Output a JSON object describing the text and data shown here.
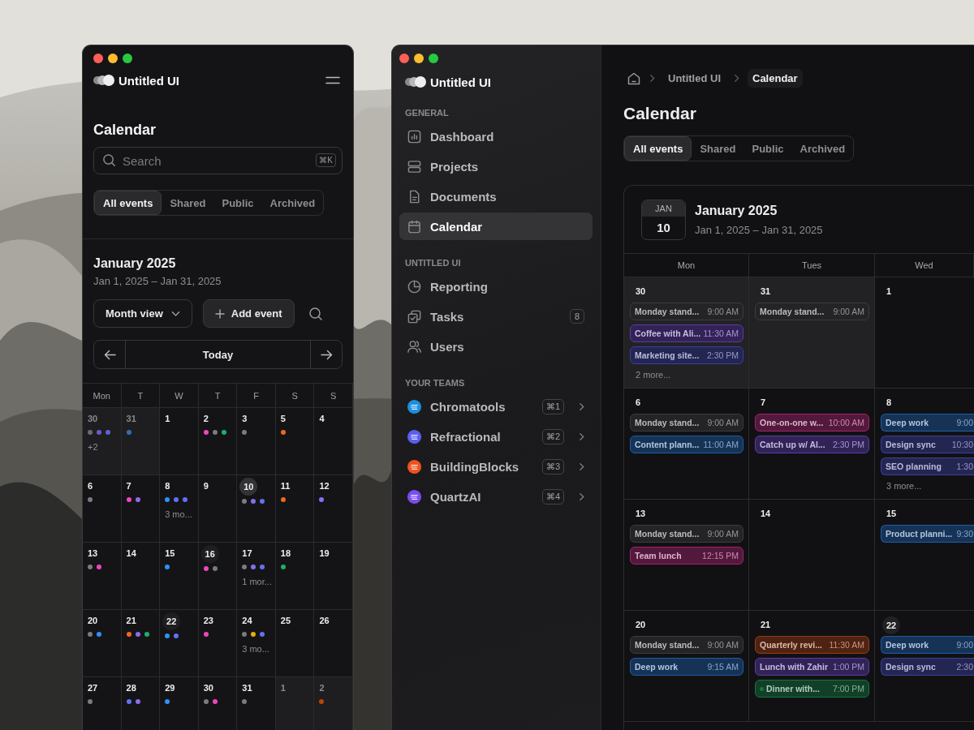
{
  "left_window": {
    "brand": "Untitled UI",
    "title": "Calendar",
    "search": {
      "placeholder": "Search",
      "shortcut": "⌘K"
    },
    "tabs": [
      {
        "label": "All events",
        "selected": true
      },
      {
        "label": "Shared",
        "selected": false
      },
      {
        "label": "Public",
        "selected": false
      },
      {
        "label": "Archived",
        "selected": false
      }
    ],
    "month": "January 2025",
    "range": "Jan 1, 2025 – Jan 31, 2025",
    "view_button": "Month view",
    "add_button": "Add event",
    "today_button": "Today",
    "weekdays": [
      "Mon",
      "T",
      "W",
      "T",
      "F",
      "S",
      "S"
    ],
    "days": [
      {
        "date": "30",
        "muted": true,
        "today": false,
        "ring": false,
        "dots": [
          {
            "color": "#6b6b70"
          },
          {
            "color": "#6e5bc4"
          },
          {
            "color": "#5b63d6"
          }
        ],
        "more": "+2"
      },
      {
        "date": "31",
        "muted": true,
        "today": false,
        "ring": false,
        "dots": [
          {
            "color": "#2f6fb8"
          }
        ]
      },
      {
        "date": "1",
        "muted": false,
        "today": false,
        "ring": false
      },
      {
        "date": "2",
        "muted": false,
        "today": false,
        "ring": false,
        "dots": [
          {
            "color": "#ee46bc"
          },
          {
            "color": "#7a7a80"
          },
          {
            "color": "#17b26a"
          }
        ]
      },
      {
        "date": "3",
        "muted": false,
        "today": false,
        "ring": false,
        "dots": [
          {
            "color": "#7a7a80"
          }
        ]
      },
      {
        "date": "5",
        "muted": false,
        "today": false,
        "ring": false,
        "dots": [
          {
            "color": "#ef6820"
          }
        ]
      },
      {
        "date": "4",
        "muted": false,
        "today": false,
        "ring": false
      },
      {
        "date": "6",
        "muted": false,
        "today": false,
        "ring": false,
        "dots": [
          {
            "color": "#7a7a80"
          }
        ]
      },
      {
        "date": "7",
        "muted": false,
        "today": false,
        "ring": false,
        "dots": [
          {
            "color": "#ee46bc"
          },
          {
            "color": "#8b6cf0"
          }
        ]
      },
      {
        "date": "8",
        "muted": false,
        "today": false,
        "ring": false,
        "dots": [
          {
            "color": "#2e90fa"
          },
          {
            "color": "#6172f3"
          },
          {
            "color": "#6172f3"
          }
        ],
        "more": "3 mo..."
      },
      {
        "date": "9",
        "muted": false,
        "today": false,
        "ring": false
      },
      {
        "date": "10",
        "muted": false,
        "today": true,
        "ring": false,
        "dots": [
          {
            "color": "#7a7a80"
          },
          {
            "color": "#8b6cf0"
          },
          {
            "color": "#6172f3"
          }
        ]
      },
      {
        "date": "11",
        "muted": false,
        "today": false,
        "ring": false,
        "dots": [
          {
            "color": "#ef6820"
          }
        ]
      },
      {
        "date": "12",
        "muted": false,
        "today": false,
        "ring": false,
        "dots": [
          {
            "color": "#8b6cf0"
          }
        ]
      },
      {
        "date": "13",
        "muted": false,
        "today": false,
        "ring": false,
        "dots": [
          {
            "color": "#7a7a80"
          },
          {
            "color": "#ee46bc"
          }
        ]
      },
      {
        "date": "14",
        "muted": false,
        "today": false,
        "ring": false
      },
      {
        "date": "15",
        "muted": false,
        "today": false,
        "ring": false,
        "dots": [
          {
            "color": "#2e90fa"
          }
        ]
      },
      {
        "date": "16",
        "muted": false,
        "today": false,
        "ring": true,
        "dots": [
          {
            "color": "#ee46bc"
          },
          {
            "color": "#7a7a80"
          }
        ]
      },
      {
        "date": "17",
        "muted": false,
        "today": false,
        "ring": false,
        "dots": [
          {
            "color": "#7a7a80"
          },
          {
            "color": "#8b6cf0"
          },
          {
            "color": "#6172f3"
          }
        ],
        "more": "1 mor..."
      },
      {
        "date": "18",
        "muted": false,
        "today": false,
        "ring": false,
        "dots": [
          {
            "color": "#17b26a"
          }
        ]
      },
      {
        "date": "19",
        "muted": false,
        "today": false,
        "ring": false
      },
      {
        "date": "20",
        "muted": false,
        "today": false,
        "ring": false,
        "dots": [
          {
            "color": "#7a7a80"
          },
          {
            "color": "#2e90fa"
          }
        ]
      },
      {
        "date": "21",
        "muted": false,
        "today": false,
        "ring": false,
        "dots": [
          {
            "color": "#ef6820"
          },
          {
            "color": "#8b6cf0"
          },
          {
            "color": "#17b26a"
          }
        ]
      },
      {
        "date": "22",
        "muted": false,
        "today": false,
        "ring": true,
        "dots": [
          {
            "color": "#2e90fa"
          },
          {
            "color": "#6172f3"
          }
        ]
      },
      {
        "date": "23",
        "muted": false,
        "today": false,
        "ring": false,
        "dots": [
          {
            "color": "#ee46bc"
          }
        ]
      },
      {
        "date": "24",
        "muted": false,
        "today": false,
        "ring": false,
        "dots": [
          {
            "color": "#7a7a80"
          },
          {
            "color": "#eaaa08"
          },
          {
            "color": "#6172f3"
          }
        ],
        "more": "3 mo..."
      },
      {
        "date": "25",
        "muted": false,
        "today": false,
        "ring": false
      },
      {
        "date": "26",
        "muted": false,
        "today": false,
        "ring": false
      },
      {
        "date": "27",
        "muted": false,
        "today": false,
        "ring": false,
        "dots": [
          {
            "color": "#7a7a80"
          }
        ]
      },
      {
        "date": "28",
        "muted": false,
        "today": false,
        "ring": false,
        "dots": [
          {
            "color": "#6172f3"
          },
          {
            "color": "#8b6cf0"
          }
        ]
      },
      {
        "date": "29",
        "muted": false,
        "today": false,
        "ring": false,
        "dots": [
          {
            "color": "#2e90fa"
          }
        ]
      },
      {
        "date": "30",
        "muted": false,
        "today": false,
        "ring": false,
        "dots": [
          {
            "color": "#7a7a80"
          },
          {
            "color": "#ee46bc"
          }
        ]
      },
      {
        "date": "31",
        "muted": false,
        "today": false,
        "ring": false,
        "dots": [
          {
            "color": "#7a7a80"
          }
        ]
      },
      {
        "date": "1",
        "muted": true,
        "today": false,
        "ring": false
      },
      {
        "date": "2",
        "muted": true,
        "today": false,
        "ring": false,
        "dots": [
          {
            "color": "#b54708"
          }
        ]
      }
    ]
  },
  "right_window": {
    "brand": "Untitled UI",
    "sidebar": {
      "sections": [
        {
          "heading": "GENERAL",
          "kind": "nav",
          "items": [
            {
              "label": "Dashboard",
              "selected": false
            },
            {
              "label": "Projects",
              "selected": false
            },
            {
              "label": "Documents",
              "selected": false
            },
            {
              "label": "Calendar",
              "selected": true
            }
          ]
        },
        {
          "heading": "UNTITLED UI",
          "kind": "nav",
          "items": [
            {
              "label": "Reporting",
              "selected": false
            },
            {
              "label": "Tasks",
              "selected": false,
              "badge": "8"
            },
            {
              "label": "Users",
              "selected": false
            }
          ]
        },
        {
          "heading": "YOUR TEAMS",
          "kind": "teams",
          "items": [
            {
              "label": "Chromatools",
              "selected": false,
              "shortcut": "⌘1",
              "color": "#1d8fe0"
            },
            {
              "label": "Refractional",
              "selected": false,
              "shortcut": "⌘2",
              "color": "#5b5ff0"
            },
            {
              "label": "BuildingBlocks",
              "selected": false,
              "shortcut": "⌘3",
              "color": "#f0521f"
            },
            {
              "label": "QuartzAI",
              "selected": false,
              "shortcut": "⌘4",
              "color": "#7a4df0"
            }
          ]
        }
      ]
    },
    "breadcrumbs": [
      {
        "label": "Untitled UI",
        "selected": false
      },
      {
        "label": "Calendar",
        "selected": true
      }
    ],
    "title": "Calendar",
    "tabs": [
      {
        "label": "All events",
        "selected": true
      },
      {
        "label": "Shared",
        "selected": false
      },
      {
        "label": "Public",
        "selected": false
      },
      {
        "label": "Archived",
        "selected": false
      }
    ],
    "date_badge": {
      "month": "JAN",
      "day": "10"
    },
    "month": "January 2025",
    "range": "Jan 1, 2025 – Jan 31, 2025",
    "weekdays": [
      "Mon",
      "Tues",
      "Wed"
    ],
    "days": [
      {
        "date": "30",
        "muted": true,
        "ring": false,
        "events": [
          {
            "title": "Monday stand...",
            "time": "9:00 AM",
            "color": "#3c3c40",
            "dot": false
          },
          {
            "title": "Coffee with Ali...",
            "time": "11:30 AM",
            "color": "#5b3aa8",
            "dot": false
          },
          {
            "title": "Marketing site...",
            "time": "2:30 PM",
            "color": "#3b3f9e",
            "dot": false
          }
        ],
        "more": "2 more..."
      },
      {
        "date": "31",
        "muted": true,
        "ring": false,
        "events": [
          {
            "title": "Monday stand...",
            "time": "9:00 AM",
            "color": "#3c3c40",
            "dot": false
          }
        ]
      },
      {
        "date": "1",
        "muted": false,
        "ring": false
      },
      {
        "date": "6",
        "muted": false,
        "ring": false,
        "events": [
          {
            "title": "Monday stand...",
            "time": "9:00 AM",
            "color": "#3c3c40",
            "dot": false
          },
          {
            "title": "Content plann...",
            "time": "11:00 AM",
            "color": "#1d5ca8",
            "dot": false
          }
        ]
      },
      {
        "date": "7",
        "muted": false,
        "ring": false,
        "events": [
          {
            "title": "One-on-one w...",
            "time": "10:00 AM",
            "color": "#a3226e",
            "dot": false
          },
          {
            "title": "Catch up w/ Al...",
            "time": "2:30 PM",
            "color": "#5b3aa8",
            "dot": false
          }
        ]
      },
      {
        "date": "8",
        "muted": false,
        "ring": false,
        "events": [
          {
            "title": "Deep work",
            "time": "9:00",
            "color": "#1d5ca8",
            "dot": false
          },
          {
            "title": "Design sync",
            "time": "10:30",
            "color": "#3b3f9e",
            "dot": false
          },
          {
            "title": "SEO planning",
            "time": "1:30",
            "color": "#3b3f9e",
            "dot": false
          }
        ],
        "more": "3 more..."
      },
      {
        "date": "13",
        "muted": false,
        "ring": false,
        "events": [
          {
            "title": "Monday stand...",
            "time": "9:00 AM",
            "color": "#3c3c40",
            "dot": false
          },
          {
            "title": "Team lunch",
            "time": "12:15 PM",
            "color": "#a3226e",
            "dot": false
          }
        ]
      },
      {
        "date": "14",
        "muted": false,
        "ring": false
      },
      {
        "date": "15",
        "muted": false,
        "ring": false,
        "events": [
          {
            "title": "Product planni...",
            "time": "9:30",
            "color": "#1d5ca8",
            "dot": false
          }
        ]
      },
      {
        "date": "20",
        "muted": false,
        "ring": false,
        "events": [
          {
            "title": "Monday stand...",
            "time": "9:00 AM",
            "color": "#3c3c40",
            "dot": false
          },
          {
            "title": "Deep work",
            "time": "9:15 AM",
            "color": "#1d5ca8",
            "dot": false
          }
        ]
      },
      {
        "date": "21",
        "muted": false,
        "ring": false,
        "events": [
          {
            "title": "Quarterly revi...",
            "time": "11:30 AM",
            "color": "#9a3a12",
            "dot": false
          },
          {
            "title": "Lunch with Zahir",
            "time": "1:00 PM",
            "color": "#5b3aa8",
            "dot": false
          },
          {
            "title": "Dinner with...",
            "time": "7:00 PM",
            "color": "#14773f",
            "dot": true
          }
        ]
      },
      {
        "date": "22",
        "muted": false,
        "ring": true,
        "events": [
          {
            "title": "Deep work",
            "time": "9:00",
            "color": "#1d5ca8",
            "dot": false
          },
          {
            "title": "Design sync",
            "time": "2:30",
            "color": "#3b3f9e",
            "dot": false
          }
        ]
      }
    ]
  }
}
